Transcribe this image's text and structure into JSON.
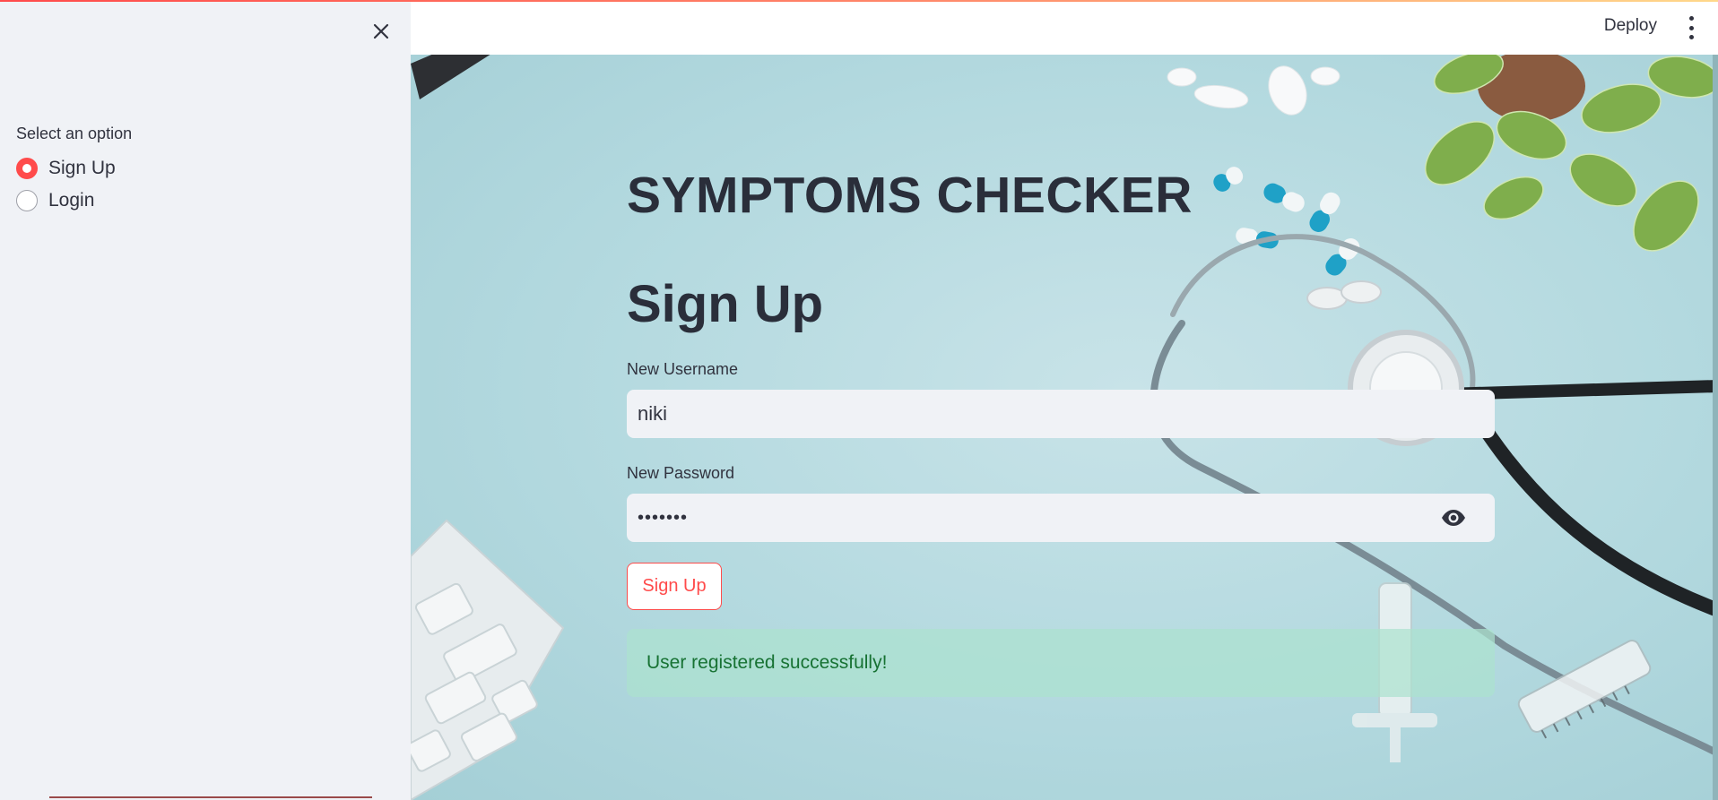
{
  "sidebar": {
    "label": "Select an option",
    "options": [
      {
        "label": "Sign Up",
        "selected": true
      },
      {
        "label": "Login",
        "selected": false
      }
    ]
  },
  "header": {
    "deploy_label": "Deploy"
  },
  "main": {
    "title": "SYMPTOMS CHECKER",
    "form_title": "Sign Up",
    "username": {
      "label": "New Username",
      "value": "niki"
    },
    "password": {
      "label": "New Password",
      "value": "•••••••"
    },
    "submit_label": "Sign Up",
    "success_message": "User registered successfully!"
  },
  "colors": {
    "accent": "#ff4b4b",
    "sidebar_bg": "#f0f2f6",
    "success_text": "#177233",
    "background_tint": "#b3d9df"
  },
  "icons": {
    "close": "close-icon",
    "menu": "kebab-menu-icon",
    "password_toggle": "eye-icon"
  }
}
